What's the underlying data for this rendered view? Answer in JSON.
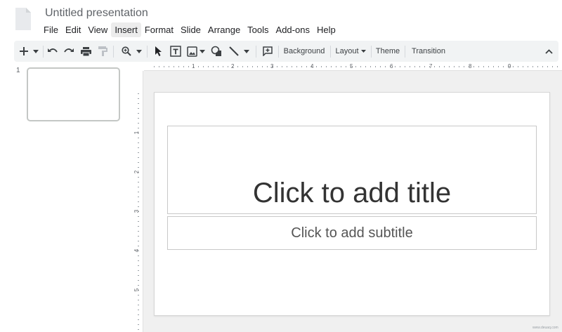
{
  "app": {
    "title": "Untitled presentation"
  },
  "menu": {
    "items": [
      "File",
      "Edit",
      "View",
      "Insert",
      "Format",
      "Slide",
      "Arrange",
      "Tools",
      "Add-ons",
      "Help"
    ],
    "active": "Insert"
  },
  "toolbar": {
    "background_label": "Background",
    "layout_label": "Layout",
    "theme_label": "Theme",
    "transition_label": "Transition"
  },
  "filmstrip": {
    "slide_number": "1"
  },
  "rulers": {
    "top": [
      "1",
      "2",
      "3",
      "4",
      "5",
      "6",
      "7",
      "8",
      "9"
    ],
    "left": [
      "1",
      "2",
      "3",
      "4",
      "5"
    ]
  },
  "slide": {
    "title_placeholder": "Click to add title",
    "subtitle_placeholder": "Click to add subtitle"
  },
  "watermark": "www.deuaq.com"
}
